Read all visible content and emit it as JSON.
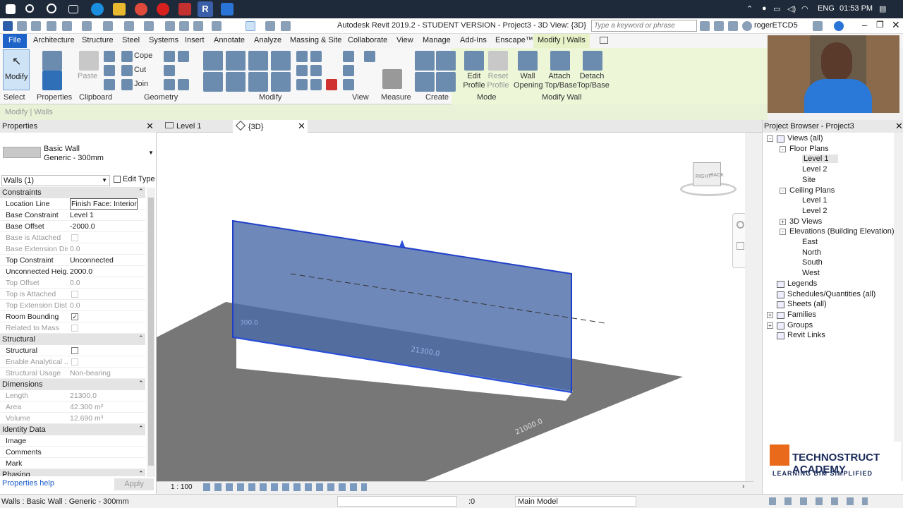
{
  "taskbar": {
    "clock": "01:53 PM",
    "lang": "ENG"
  },
  "app": {
    "title": "Autodesk Revit 2019.2 - STUDENT VERSION - Project3 - 3D View: {3D}",
    "search_placeholder": "Type a keyword or phrase",
    "user": "rogerETCD5"
  },
  "tabs": [
    "File",
    "Architecture",
    "Structure",
    "Steel",
    "Systems",
    "Insert",
    "Annotate",
    "Analyze",
    "Massing & Site",
    "Collaborate",
    "View",
    "Manage",
    "Add-Ins",
    "Enscape™",
    "Modify | Walls"
  ],
  "ribbon": {
    "modify": "Modify",
    "paste": "Paste",
    "cope": "Cope",
    "cut": "Cut",
    "join": "Join",
    "edit_profile": "Edit Profile",
    "reset_profile": "Reset Profile",
    "wall_opening": "Wall Opening",
    "attach": "Attach Top/Base",
    "detach": "Detach Top/Base",
    "panels": [
      "Select",
      "Properties",
      "Clipboard",
      "Geometry",
      "Modify",
      "View",
      "Measure",
      "Create",
      "Mode",
      "Modify Wall"
    ],
    "sub_bar": "Modify | Walls"
  },
  "properties": {
    "header": "Properties",
    "type_family": "Basic Wall",
    "type_name": "Generic - 300mm",
    "selector": "Walls (1)",
    "edit_type": "Edit Type",
    "groups": [
      {
        "name": "Constraints",
        "rows": [
          {
            "k": "Location Line",
            "v": "Finish Face: Interior",
            "dim": false
          },
          {
            "k": "Base Constraint",
            "v": "Level 1",
            "dim": false
          },
          {
            "k": "Base Offset",
            "v": "-2000.0",
            "dim": false
          },
          {
            "k": "Base is Attached",
            "v": "",
            "dim": true,
            "check": "off"
          },
          {
            "k": "Base Extension Dis...",
            "v": "0.0",
            "dim": true
          },
          {
            "k": "Top Constraint",
            "v": "Unconnected",
            "dim": false
          },
          {
            "k": "Unconnected Heig...",
            "v": "2000.0",
            "dim": false
          },
          {
            "k": "Top Offset",
            "v": "0.0",
            "dim": true
          },
          {
            "k": "Top is Attached",
            "v": "",
            "dim": true,
            "check": "off"
          },
          {
            "k": "Top Extension Dist...",
            "v": "0.0",
            "dim": true
          },
          {
            "k": "Room Bounding",
            "v": "",
            "dim": false,
            "check": "on"
          },
          {
            "k": "Related to Mass",
            "v": "",
            "dim": true,
            "check": "off"
          }
        ]
      },
      {
        "name": "Structural",
        "rows": [
          {
            "k": "Structural",
            "v": "",
            "dim": false,
            "check": "off"
          },
          {
            "k": "Enable Analytical ...",
            "v": "",
            "dim": true,
            "check": "off"
          },
          {
            "k": "Structural Usage",
            "v": "Non-bearing",
            "dim": true
          }
        ]
      },
      {
        "name": "Dimensions",
        "rows": [
          {
            "k": "Length",
            "v": "21300.0",
            "dim": true
          },
          {
            "k": "Area",
            "v": "42.300 m²",
            "dim": true
          },
          {
            "k": "Volume",
            "v": "12.690 m³",
            "dim": true
          }
        ]
      },
      {
        "name": "Identity Data",
        "rows": [
          {
            "k": "Image",
            "v": "",
            "dim": false
          },
          {
            "k": "Comments",
            "v": "",
            "dim": false
          },
          {
            "k": "Mark",
            "v": "",
            "dim": false
          }
        ]
      },
      {
        "name": "Phasing",
        "rows": []
      }
    ],
    "help": "Properties help",
    "apply": "Apply"
  },
  "view_tabs": [
    {
      "label": "Level 1",
      "active": false
    },
    {
      "label": "{3D}",
      "active": true
    }
  ],
  "canvas": {
    "dim1": "21300.0",
    "dim2": "21000.0",
    "dim3": "300.0",
    "scale": "1 : 100"
  },
  "project_browser": {
    "header": "Project Browser - Project3",
    "items": [
      {
        "label": "Views (all)",
        "level": 0,
        "sign": "-"
      },
      {
        "label": "Floor Plans",
        "level": 1,
        "sign": "-"
      },
      {
        "label": "Level 1",
        "level": 2,
        "selected": true
      },
      {
        "label": "Level 2",
        "level": 2
      },
      {
        "label": "Site",
        "level": 2
      },
      {
        "label": "Ceiling Plans",
        "level": 1,
        "sign": "-"
      },
      {
        "label": "Level 1",
        "level": 2
      },
      {
        "label": "Level 2",
        "level": 2
      },
      {
        "label": "3D Views",
        "level": 1,
        "sign": "+"
      },
      {
        "label": "Elevations (Building Elevation)",
        "level": 1,
        "sign": "-"
      },
      {
        "label": "East",
        "level": 2
      },
      {
        "label": "North",
        "level": 2
      },
      {
        "label": "South",
        "level": 2
      },
      {
        "label": "West",
        "level": 2
      },
      {
        "label": "Legends",
        "level": 0
      },
      {
        "label": "Schedules/Quantities (all)",
        "level": 0
      },
      {
        "label": "Sheets (all)",
        "level": 0
      },
      {
        "label": "Families",
        "level": 0,
        "sign": "+"
      },
      {
        "label": "Groups",
        "level": 0,
        "sign": "+"
      },
      {
        "label": "Revit Links",
        "level": 0
      }
    ]
  },
  "status": {
    "text": "Walls : Basic Wall : Generic - 300mm",
    "model": "Main Model",
    "zero": ":0"
  },
  "logo": {
    "line1": "TECHNOSTRUCT ACADEMY",
    "line2": "LEARNING BIM SIMPLIFIED"
  },
  "viewcube": {
    "right": "RIGHT",
    "back": "BACK"
  }
}
